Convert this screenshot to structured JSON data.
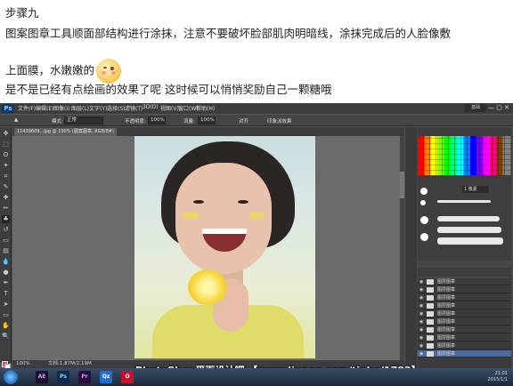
{
  "post": {
    "line1": "步骤九",
    "line2": "图案图章工具顺面部结构进行涂抹，注意不要破坏脸部肌肉明暗线，涂抹完成后的人脸像敷",
    "line3": "上面膜，水嫩嫩的",
    "line4": "是不是已经有点绘画的效果了呢 这时候可以悄悄奖励自己一颗糖哦",
    "emoji_icon": "blush-smile-emoji"
  },
  "photoshop": {
    "logo": "Ps",
    "menus": [
      "文件(F)",
      "编辑(E)",
      "图像(I)",
      "图层(L)",
      "文字(Y)",
      "选择(S)",
      "滤镜(T)",
      "3D(D)",
      "视图(V)",
      "窗口(W)",
      "帮助(H)"
    ],
    "workspace": "基础",
    "window_controls": "— ▢ ✕",
    "options": {
      "mode_label": "模式:",
      "mode_value": "正常",
      "opacity_label": "不透明度:",
      "opacity_value": "100%",
      "flow_label": "流量:",
      "flow_value": "100%",
      "aligned_label": "对齐",
      "impressionist_label": "印象派效果"
    },
    "doc_tab": "11439609...jpg @ 100% (图案图章, RGB/8#)",
    "status_zoom": "100%",
    "status_doc": "文档:1.87M/2.19M",
    "brush_size": "1 像素",
    "layer_name": "图层图章",
    "layer_count": 10
  },
  "taskbar": {
    "apps": [
      "AE",
      "Ps",
      "Pr",
      "Qz",
      "O"
    ],
    "clock_time": "21:01",
    "clock_date": "2015/1/1"
  },
  "watermark": "PhotoShop平面设计吧 【www.lineeg.com/tieba/1783】",
  "colors": {
    "ps_bg": "#535353",
    "foreground_swatch": "#e45563",
    "taskbar": "#1d2a3d"
  }
}
